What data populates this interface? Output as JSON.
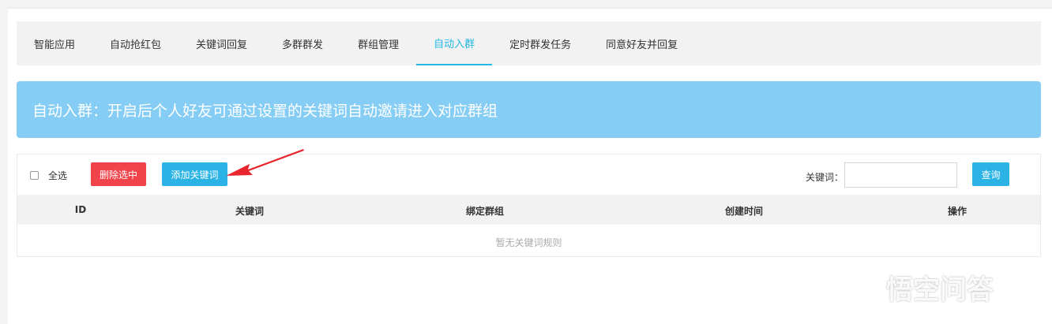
{
  "tabs": [
    {
      "label": "智能应用"
    },
    {
      "label": "自动抢红包"
    },
    {
      "label": "关键词回复"
    },
    {
      "label": "多群群发"
    },
    {
      "label": "群组管理"
    },
    {
      "label": "自动入群",
      "active": true
    },
    {
      "label": "定时群发任务"
    },
    {
      "label": "同意好友并回复"
    }
  ],
  "banner": {
    "text": "自动入群：开启后个人好友可通过设置的关键词自动邀请进入对应群组"
  },
  "toolbar": {
    "select_all": "全选",
    "delete_selected": "删除选中",
    "add_keyword": "添加关键词",
    "keyword_label": "关键词：",
    "keyword_value": "",
    "search": "查询"
  },
  "table": {
    "columns": [
      "ID",
      "关键词",
      "绑定群组",
      "创建时间",
      "操作"
    ],
    "empty_text": "暂无关键词规则"
  },
  "watermark": {
    "text": "悟空问答"
  },
  "colors": {
    "accent": "#23b7e5",
    "banner": "#86cdf6",
    "danger": "#f0434a",
    "arrow": "#e8262d"
  }
}
